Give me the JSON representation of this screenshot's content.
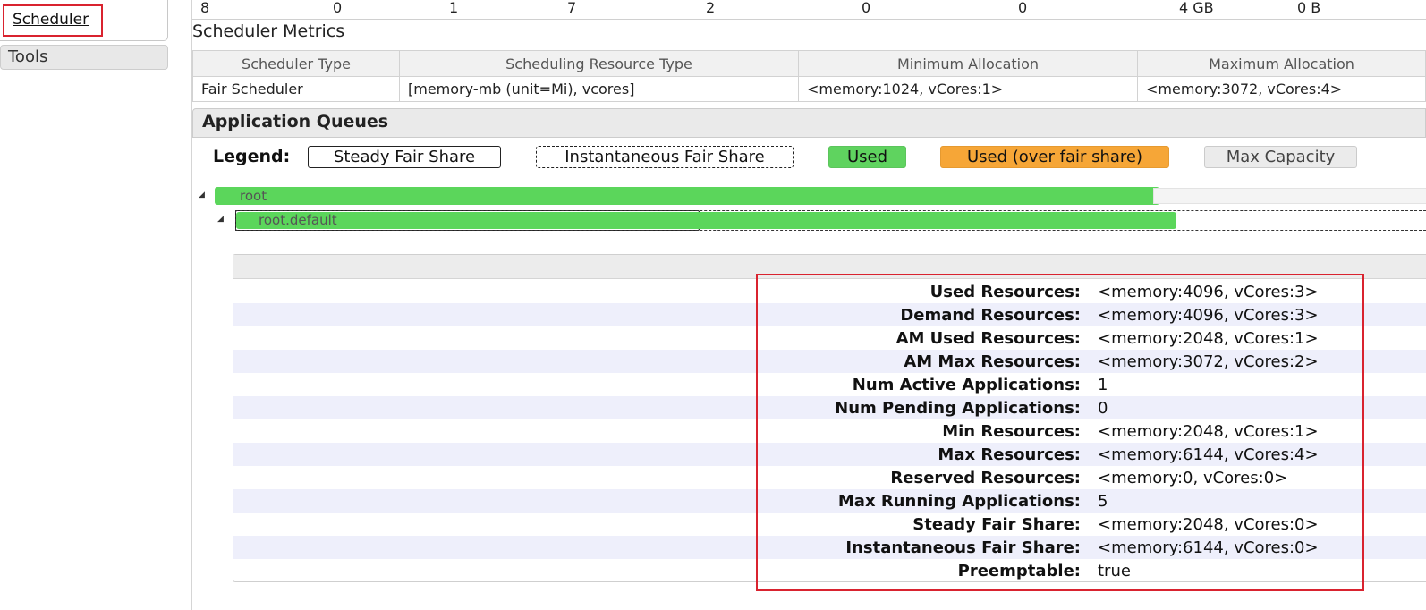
{
  "sidebar": {
    "scheduler_link": "Scheduler",
    "tools": "Tools"
  },
  "cluster_metrics_row": [
    "8",
    "0",
    "1",
    "7",
    "2",
    "0",
    "0",
    "4 GB",
    "0 B"
  ],
  "scheduler_metrics": {
    "title": "Scheduler Metrics",
    "headers": [
      "Scheduler Type",
      "Scheduling Resource Type",
      "Minimum Allocation",
      "Maximum Allocation"
    ],
    "row": [
      "Fair Scheduler",
      "[memory-mb (unit=Mi), vcores]",
      "<memory:1024, vCores:1>",
      "<memory:3072, vCores:4>"
    ]
  },
  "application_queues": {
    "title": "Application Queues",
    "legend": {
      "label": "Legend:",
      "steady": "Steady Fair Share",
      "instantaneous": "Instantaneous Fair Share",
      "used": "Used",
      "over": "Used (over fair share)",
      "max": "Max Capacity"
    },
    "queues": [
      {
        "name": "root",
        "used_fraction": 0.78
      },
      {
        "name": "root.default",
        "used_fraction": 0.79
      }
    ]
  },
  "queue_details": [
    {
      "label": "Used Resources:",
      "value": "<memory:4096, vCores:3>"
    },
    {
      "label": "Demand Resources:",
      "value": "<memory:4096, vCores:3>"
    },
    {
      "label": "AM Used Resources:",
      "value": "<memory:2048, vCores:1>"
    },
    {
      "label": "AM Max Resources:",
      "value": "<memory:3072, vCores:2>"
    },
    {
      "label": "Num Active Applications:",
      "value": "1"
    },
    {
      "label": "Num Pending Applications:",
      "value": "0"
    },
    {
      "label": "Min Resources:",
      "value": "<memory:2048, vCores:1>"
    },
    {
      "label": "Max Resources:",
      "value": "<memory:6144, vCores:4>"
    },
    {
      "label": "Reserved Resources:",
      "value": "<memory:0, vCores:0>"
    },
    {
      "label": "Max Running Applications:",
      "value": "5"
    },
    {
      "label": "Steady Fair Share:",
      "value": "<memory:2048, vCores:0>"
    },
    {
      "label": "Instantaneous Fair Share:",
      "value": "<memory:6144, vCores:0>"
    },
    {
      "label": "Preemptable:",
      "value": "true"
    }
  ],
  "colors": {
    "used": "#5bd65b",
    "over_fair_share": "#f6a637",
    "highlight": "#d9232f",
    "row_alt": "#eeeffb"
  }
}
